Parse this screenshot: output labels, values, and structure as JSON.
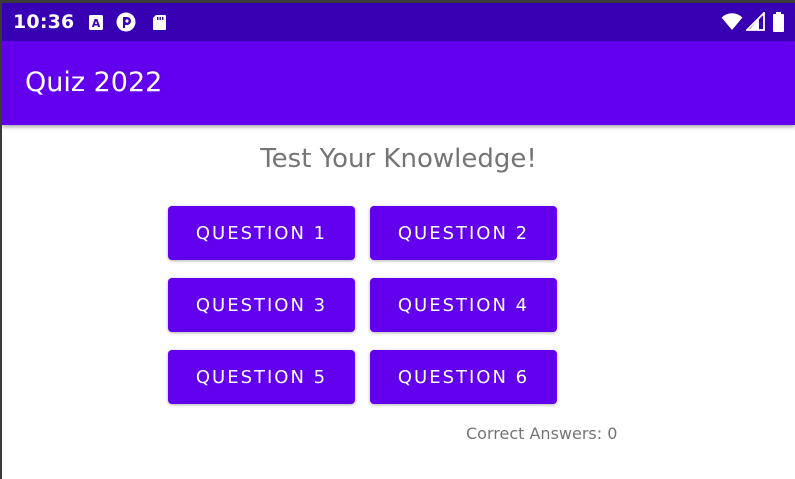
{
  "status_bar": {
    "time": "10:36",
    "left_icons": [
      "accessibility-icon",
      "app-notification-icon",
      "sd-card-icon"
    ],
    "right_icons": [
      "wifi-icon",
      "cellular-signal-icon",
      "battery-icon"
    ]
  },
  "app_bar": {
    "title": "Quiz 2022"
  },
  "main": {
    "headline": "Test Your Knowledge!",
    "buttons": [
      {
        "label": "QUESTION 1"
      },
      {
        "label": "QUESTION 2"
      },
      {
        "label": "QUESTION 3"
      },
      {
        "label": "QUESTION 4"
      },
      {
        "label": "QUESTION 5"
      },
      {
        "label": "QUESTION 6"
      }
    ],
    "score_text": "Correct Answers: 0"
  },
  "colors": {
    "status_bar": "#3700b3",
    "primary": "#6200ee",
    "text_secondary": "#757575",
    "background": "#ffffff"
  }
}
